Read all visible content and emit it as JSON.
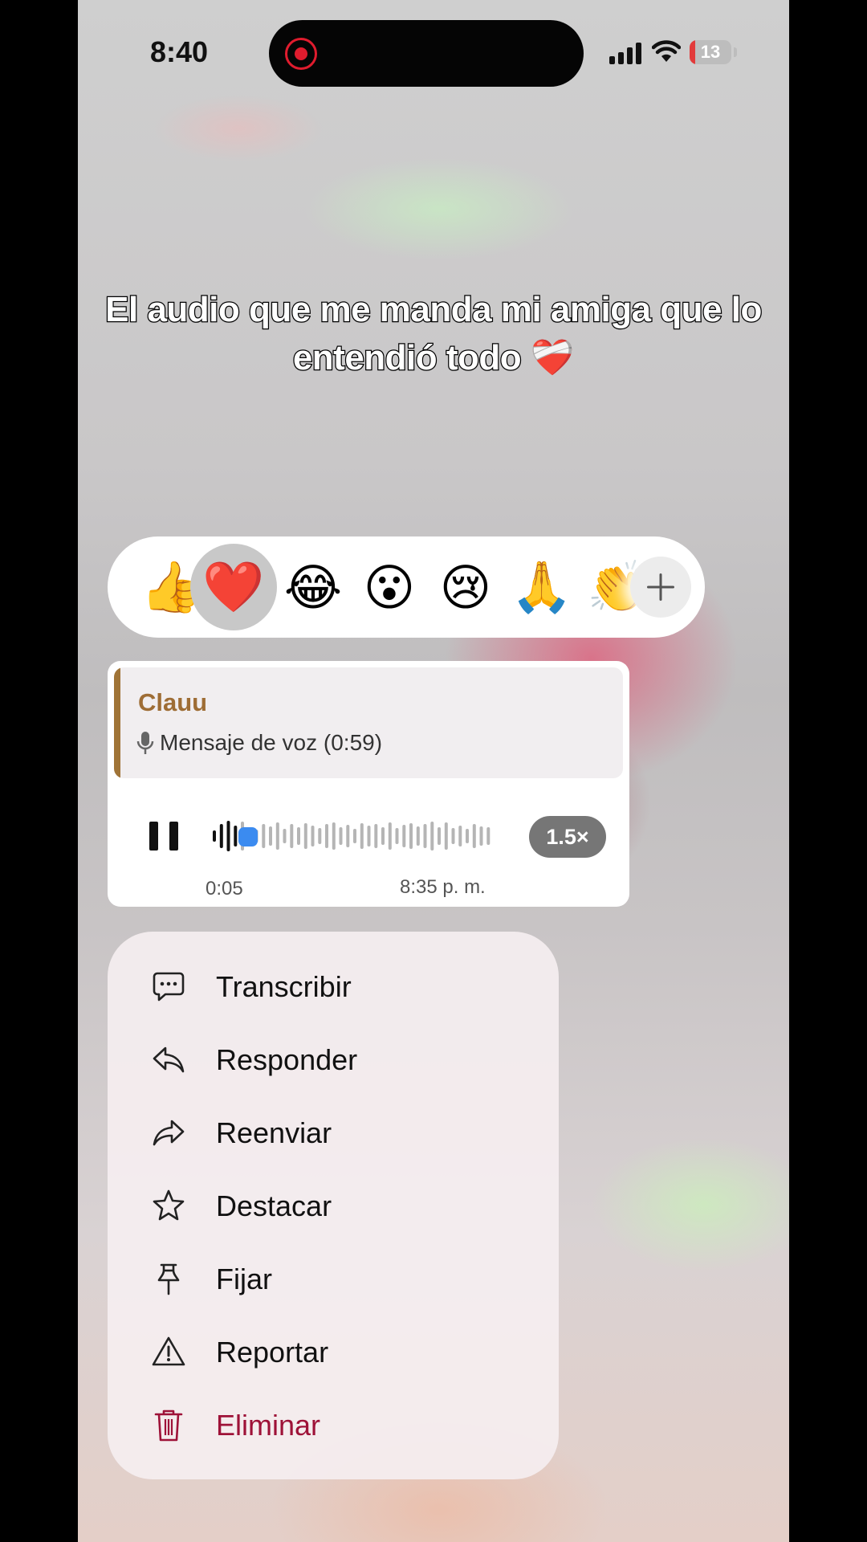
{
  "status_bar": {
    "time": "8:40",
    "battery": "13",
    "battery_fraction": 0.13
  },
  "caption": {
    "text": "El audio que me manda mi amiga que lo entendió todo ❤️‍🩹"
  },
  "reactions": {
    "items": [
      {
        "emoji": "👍",
        "name": "thumbs-up"
      },
      {
        "emoji": "❤️",
        "name": "heart",
        "selected": true
      },
      {
        "emoji": "😂",
        "name": "laughing"
      },
      {
        "emoji": "😮",
        "name": "surprised"
      },
      {
        "emoji": "😢",
        "name": "crying"
      },
      {
        "emoji": "🙏",
        "name": "praying-hands"
      },
      {
        "emoji": "👏",
        "name": "clapping"
      }
    ],
    "more_icon": "plus-icon"
  },
  "message": {
    "quote": {
      "author": "Clauu",
      "text": "Mensaje de voz (0:59)",
      "icon": "microphone-icon"
    },
    "playback_icon": "pause-icon",
    "speed": "1.5×",
    "elapsed": "0:05",
    "timestamp": "8:35 p. m.",
    "progress_fraction": 0.09
  },
  "menu": {
    "items": [
      {
        "label": "Transcribir",
        "icon": "speech-bubble-icon"
      },
      {
        "label": "Responder",
        "icon": "reply-icon"
      },
      {
        "label": "Reenviar",
        "icon": "forward-icon"
      },
      {
        "label": "Destacar",
        "icon": "star-icon"
      },
      {
        "label": "Fijar",
        "icon": "pin-icon"
      },
      {
        "label": "Reportar",
        "icon": "warning-icon"
      },
      {
        "label": "Eliminar",
        "icon": "trash-icon",
        "destructive": true
      }
    ]
  },
  "colors": {
    "quote_accent": "#a07437",
    "scrubber": "#3b8bf0",
    "destructive": "#9e1238",
    "recording": "#e01c2e"
  }
}
